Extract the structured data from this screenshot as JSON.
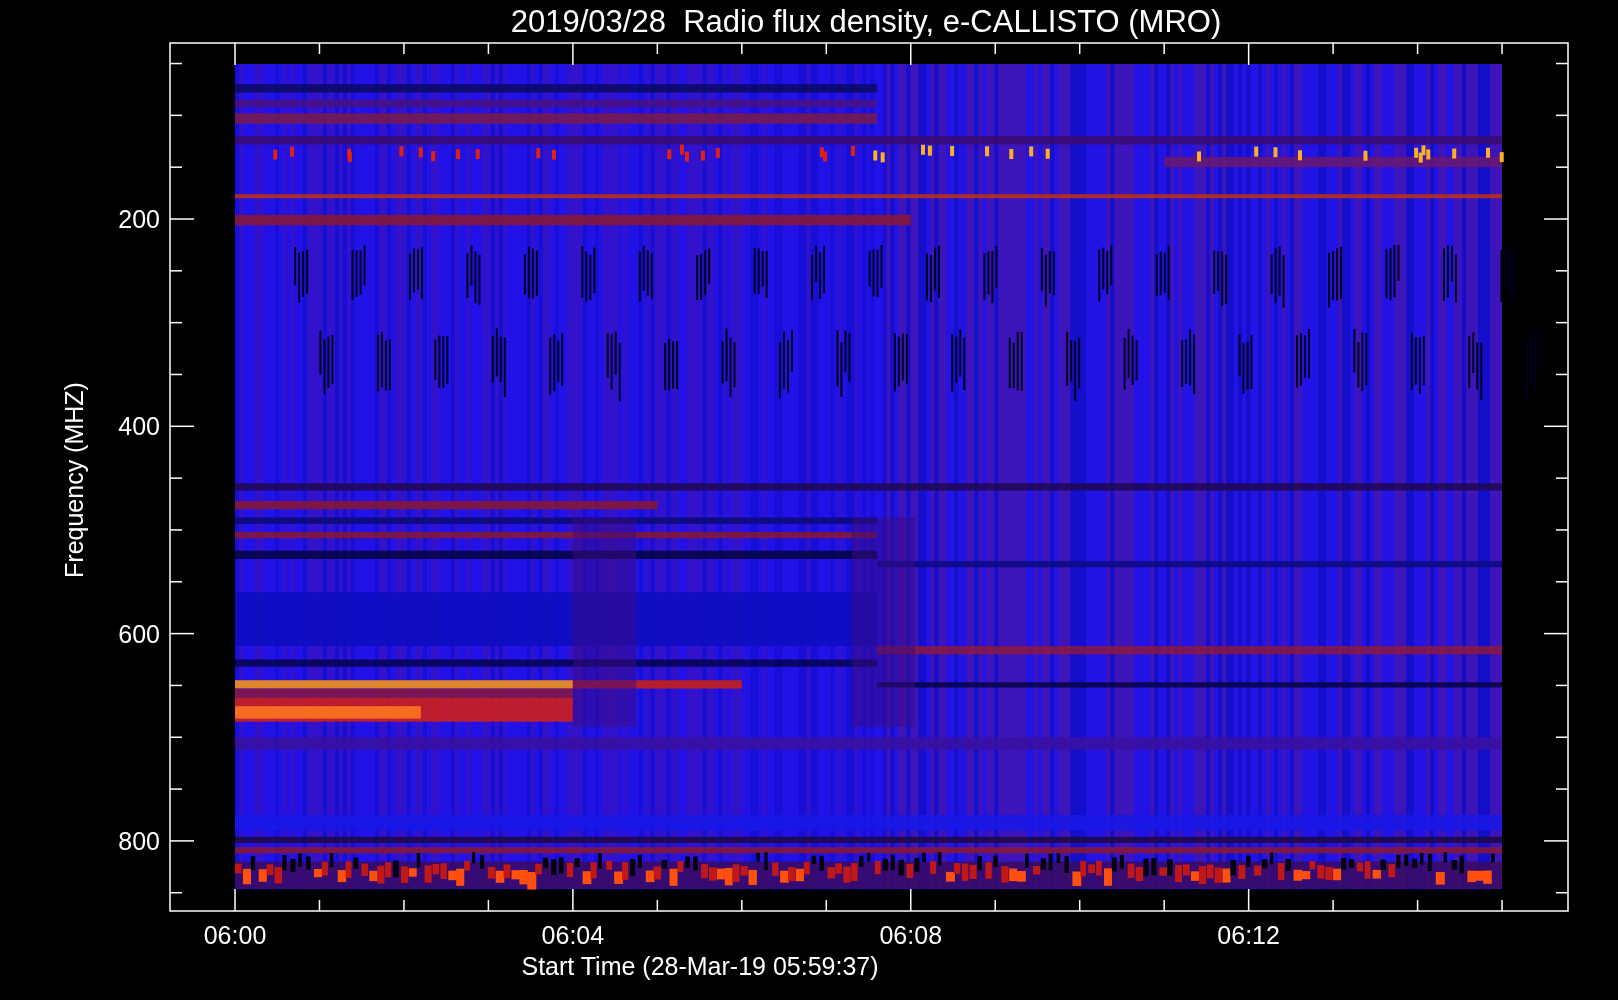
{
  "title": "2019/03/28  Radio flux density, e-CALLISTO (MRO)",
  "y_axis": {
    "label": "Frequency (MHZ)",
    "ticks": [
      "200",
      "400",
      "600",
      "800"
    ]
  },
  "x_axis": {
    "label": "Start Time (28-Mar-19 05:59:37)",
    "ticks": [
      "06:00",
      "06:04",
      "06:08",
      "06:12"
    ]
  }
}
